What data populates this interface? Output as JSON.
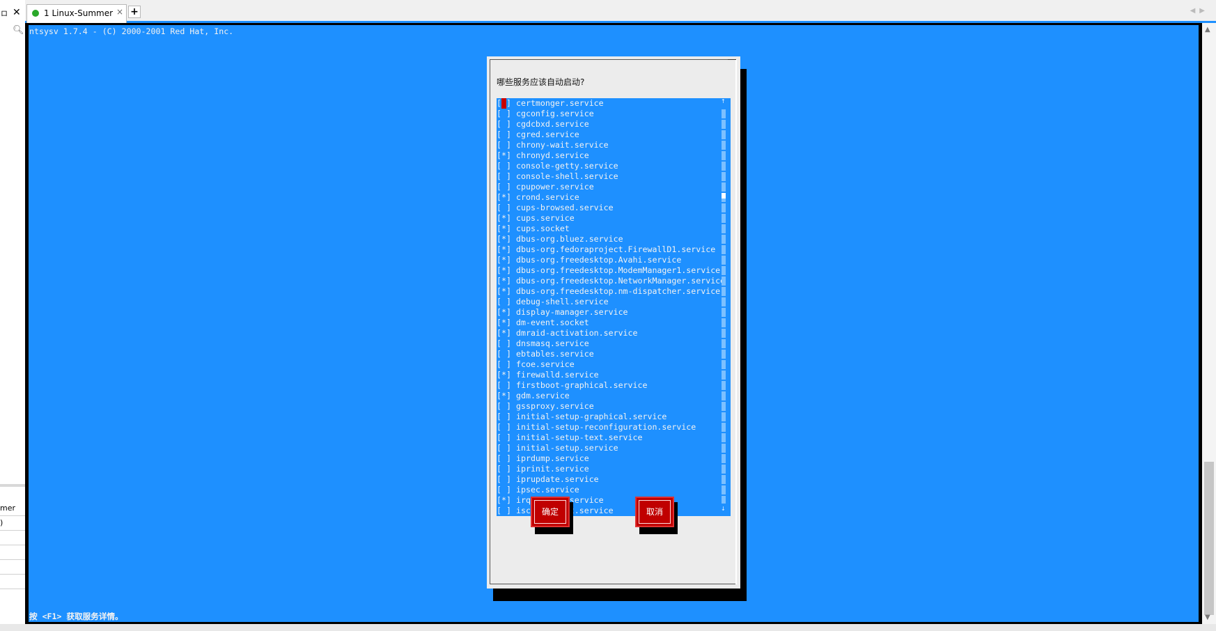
{
  "tab": {
    "label": "1 Linux-Summer",
    "close": "×",
    "add": "+"
  },
  "left_panel": {
    "pin": "ロ",
    "close": "✕",
    "rows": [
      "mer",
      ")",
      "",
      "",
      "",
      ""
    ]
  },
  "terminal": {
    "header": "ntsysv 1.7.4 - (C) 2000-2001 Red Hat, Inc.",
    "footer": "按 <F1> 获取服务详情。"
  },
  "dialog": {
    "title": "哪些服务应该自动启动?",
    "ok_label": "确定",
    "cancel_label": "取消",
    "services": [
      {
        "name": "certmonger.service",
        "enabled": false,
        "cursor": true
      },
      {
        "name": "cgconfig.service",
        "enabled": false
      },
      {
        "name": "cgdcbxd.service",
        "enabled": false
      },
      {
        "name": "cgred.service",
        "enabled": false
      },
      {
        "name": "chrony-wait.service",
        "enabled": false
      },
      {
        "name": "chronyd.service",
        "enabled": true
      },
      {
        "name": "console-getty.service",
        "enabled": false
      },
      {
        "name": "console-shell.service",
        "enabled": false
      },
      {
        "name": "cpupower.service",
        "enabled": false
      },
      {
        "name": "crond.service",
        "enabled": true
      },
      {
        "name": "cups-browsed.service",
        "enabled": false
      },
      {
        "name": "cups.service",
        "enabled": true
      },
      {
        "name": "cups.socket",
        "enabled": true
      },
      {
        "name": "dbus-org.bluez.service",
        "enabled": true
      },
      {
        "name": "dbus-org.fedoraproject.FirewallD1.service",
        "enabled": true
      },
      {
        "name": "dbus-org.freedesktop.Avahi.service",
        "enabled": true
      },
      {
        "name": "dbus-org.freedesktop.ModemManager1.service",
        "enabled": true
      },
      {
        "name": "dbus-org.freedesktop.NetworkManager.service",
        "enabled": true
      },
      {
        "name": "dbus-org.freedesktop.nm-dispatcher.service",
        "enabled": true
      },
      {
        "name": "debug-shell.service",
        "enabled": false
      },
      {
        "name": "display-manager.service",
        "enabled": true
      },
      {
        "name": "dm-event.socket",
        "enabled": true
      },
      {
        "name": "dmraid-activation.service",
        "enabled": true
      },
      {
        "name": "dnsmasq.service",
        "enabled": false
      },
      {
        "name": "ebtables.service",
        "enabled": false
      },
      {
        "name": "fcoe.service",
        "enabled": false
      },
      {
        "name": "firewalld.service",
        "enabled": true
      },
      {
        "name": "firstboot-graphical.service",
        "enabled": false
      },
      {
        "name": "gdm.service",
        "enabled": true
      },
      {
        "name": "gssproxy.service",
        "enabled": false
      },
      {
        "name": "initial-setup-graphical.service",
        "enabled": false
      },
      {
        "name": "initial-setup-reconfiguration.service",
        "enabled": false
      },
      {
        "name": "initial-setup-text.service",
        "enabled": false
      },
      {
        "name": "initial-setup.service",
        "enabled": false
      },
      {
        "name": "iprdump.service",
        "enabled": false
      },
      {
        "name": "iprinit.service",
        "enabled": false
      },
      {
        "name": "iprupdate.service",
        "enabled": false
      },
      {
        "name": "ipsec.service",
        "enabled": false
      },
      {
        "name": "irqbalance.service",
        "enabled": true
      },
      {
        "name": "iscsi-onboot.service",
        "enabled": false
      }
    ],
    "scroll_up": "↑",
    "scroll_down": "↓"
  },
  "colors": {
    "terminal_bg": "#1e90ff",
    "button_bg": "#c00000",
    "cursor": "#c80000"
  }
}
